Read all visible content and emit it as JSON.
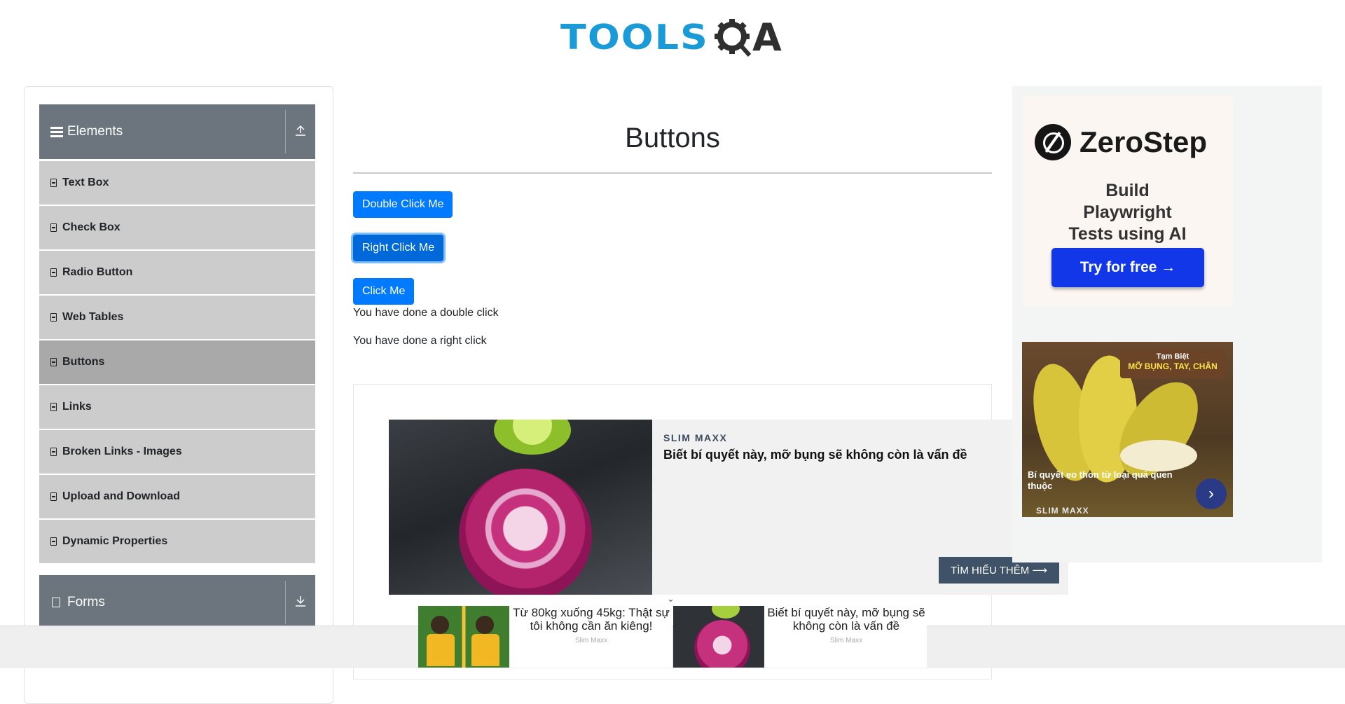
{
  "logo": {
    "part1": "TOOLS",
    "part2": "A"
  },
  "sidebar": {
    "elements_header": "Elements",
    "items": [
      {
        "label": "Text Box"
      },
      {
        "label": "Check Box"
      },
      {
        "label": "Radio Button"
      },
      {
        "label": "Web Tables"
      },
      {
        "label": "Buttons",
        "active": true
      },
      {
        "label": "Links"
      },
      {
        "label": "Broken Links - Images"
      },
      {
        "label": "Upload and Download"
      },
      {
        "label": "Dynamic Properties"
      }
    ],
    "forms_header": "Forms"
  },
  "main": {
    "title": "Buttons",
    "double_click_btn": "Double Click Me",
    "right_click_btn": "Right Click Me",
    "click_btn": "Click Me",
    "double_click_msg": "You have done a double click",
    "right_click_msg": "You have done a right click"
  },
  "promo": {
    "brand": "SLIM MAXX",
    "headline": "Biết bí quyết này, mỡ bụng sẽ không còn là vấn đề",
    "cta": "TÌM HIỂU THÊM ⟶"
  },
  "zerostep_ad": {
    "name": "ZeroStep",
    "subtitle": "Build Playwright Tests using AI",
    "button": "Try for free →"
  },
  "banana_ad": {
    "sign_line1": "Tạm Biệt",
    "sign_line2": "MỠ BỤNG, TAY, CHÂN",
    "caption": "Bí quyết eo thon từ loại quả quen thuộc",
    "brand": "SLIM MAXX"
  },
  "bottom_ads": [
    {
      "text": "Từ 80kg xuống 45kg: Thật sự tôi không cần ăn kiêng!",
      "brand": "Slim Maxx"
    },
    {
      "text": "Biết bí quyết này, mỡ bụng sẽ không còn là vấn đề",
      "brand": "Slim Maxx"
    }
  ],
  "colors": {
    "primary": "#007bff",
    "sidebar_header": "#6c757d",
    "menu_item": "#cccccc",
    "menu_active": "#a9a9a9",
    "logo_blue": "#1a9bd7"
  }
}
